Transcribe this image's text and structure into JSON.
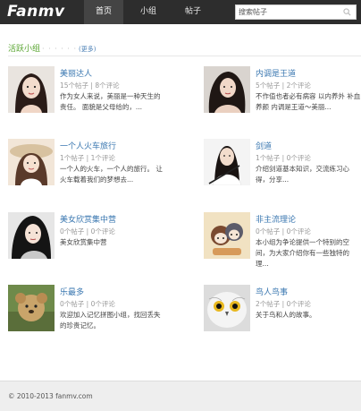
{
  "header": {
    "logo": "Fanmv",
    "nav": [
      {
        "label": "首页",
        "active": true
      },
      {
        "label": "小组",
        "active": false
      },
      {
        "label": "帖子",
        "active": false
      }
    ],
    "search": {
      "placeholder": "搜索帖子",
      "icon": "search-icon"
    }
  },
  "section": {
    "title": "活跃小组",
    "dots": "· · · · · ·",
    "more": "(更多)"
  },
  "groups": [
    {
      "name": "美丽达人",
      "stats": "15个帖子 | 8个评论",
      "desc": "作为女人来说，美丽是一种天生的责任。 面貌是父母给的，..."
    },
    {
      "name": "内调是王道",
      "stats": "5个帖子 | 2个评论",
      "desc": "不作值也者必有病容 以内养外 补血养颜 内调是王道～美丽..."
    },
    {
      "name": "一个人火车旅行",
      "stats": "1个帖子 | 1个评论",
      "desc": "一个人的火车，一个人的旅行。 让火车载着我们的梦想去..."
    },
    {
      "name": "剑道",
      "stats": "1个帖子 | 0个评论",
      "desc": "介绍剑道基本知识，交流练习心得，分享..."
    },
    {
      "name": "美女欣赏集中营",
      "stats": "0个帖子 | 0个评论",
      "desc": "美女欣赏集中营"
    },
    {
      "name": "非主流理论",
      "stats": "0个帖子 | 0个评论",
      "desc": "本小组为争论提供一个特别的空间，为大家介绍你有一些独特的理..."
    },
    {
      "name": "乐最多",
      "stats": "0个帖子 | 0个评论",
      "desc": "欢迎加入记忆拼图小组，找回丢失的珍贵记忆。"
    },
    {
      "name": "鸟人鸟事",
      "stats": "2个帖子 | 0个评论",
      "desc": "关于鸟和人的故事。"
    }
  ],
  "footer": {
    "text": "© 2010-2013 fanmv.com"
  }
}
